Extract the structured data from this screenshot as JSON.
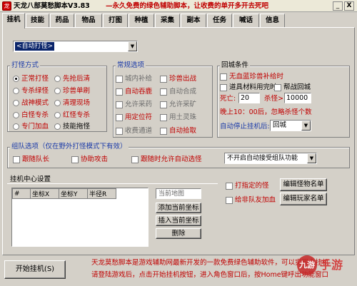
{
  "window": {
    "title": "天龙八部莫愁脚本V3.83",
    "slogan": "—永久免费的绿色辅助脚本，让收费的单开多开去死吧",
    "buttons": {
      "minimize": "_",
      "close": "X"
    }
  },
  "tabs": [
    "挂机",
    "技能",
    "药品",
    "物品",
    "打图",
    "种植",
    "采集",
    "副本",
    "任务",
    "喊话",
    "信息"
  ],
  "active_tab": "挂机",
  "route_select": {
    "value": "<自动打怪>"
  },
  "fight_mode": {
    "title": "打怪方式",
    "options": [
      {
        "label": "正常打怪",
        "checked": true
      },
      {
        "label": "先抢后清",
        "checked": false
      },
      {
        "label": "专杀绿怪",
        "checked": false
      },
      {
        "label": "珍兽单刷",
        "checked": false
      },
      {
        "label": "战神模式",
        "checked": false
      },
      {
        "label": "清理现场",
        "checked": false
      },
      {
        "label": "白怪专杀",
        "checked": false
      },
      {
        "label": "红怪专杀",
        "checked": false
      },
      {
        "label": "专门加血",
        "checked": false
      },
      {
        "label": "技能拖怪",
        "checked": false
      }
    ]
  },
  "common": {
    "title": "常规选项",
    "options": [
      {
        "label": "城内补给",
        "checked": false,
        "style": "gray"
      },
      {
        "label": "珍兽出战",
        "checked": false,
        "style": "red"
      },
      {
        "label": "自动吞鹿",
        "checked": false,
        "style": "red"
      },
      {
        "label": "自动合成",
        "checked": false,
        "style": "gray"
      },
      {
        "label": "允许采药",
        "checked": false,
        "style": "gray"
      },
      {
        "label": "允许采矿",
        "checked": false,
        "style": "gray"
      },
      {
        "label": "用定位符",
        "checked": false,
        "style": "red"
      },
      {
        "label": "用土灵珠",
        "checked": false,
        "style": "gray"
      },
      {
        "label": "收费通道",
        "checked": false,
        "style": "gray"
      },
      {
        "label": "自动拾取",
        "checked": false,
        "style": "red"
      }
    ]
  },
  "return_city": {
    "title": "回城条件",
    "no_pet_supply": "无血蓝珍兽补给时",
    "out_of_items": "道具材料用完时",
    "gang_return": "帮战回城",
    "death_label": "死亡:",
    "death_value": "20",
    "kill_label": "杀怪>",
    "kill_value": "10000",
    "note": "晚上10：00后，忽略杀怪个数",
    "auto_stop_label": "自动停止挂机后:",
    "auto_stop_value": "回城"
  },
  "team": {
    "title": "组队选项（仅在野外打怪模式下有效）",
    "follow_captain": "跟随队长",
    "assist_attack": "协助攻击",
    "follow_allow_auto": "跟随时允许自动选怪",
    "invite_select": "不开启自动接受组队功能"
  },
  "center": {
    "title": "挂机中心设置",
    "columns": [
      "#",
      "坐标X",
      "坐标Y",
      "半径R"
    ],
    "map_placeholder": "当前地图",
    "add_button": "添加当前坐标",
    "insert_button": "插入当前坐标",
    "delete_button": "删除"
  },
  "target": {
    "hit_specific": "打指定的怪",
    "edit_monster": "编辑怪物名单",
    "heal_friends": "给非队友加血",
    "edit_player": "编辑玩家名单"
  },
  "footer": {
    "start_button": "开始挂机(S)",
    "notice_line1": "天龙莫愁脚本是游戏辅助网最新开发的一款免费绿色辅助软件，可以实现全挂机",
    "notice_line2": "请登陆游戏后，点击开始挂机按钮，进入角色窗口后，按Home键呼出功能窗口"
  },
  "watermark": {
    "brand": "九游",
    "text": "手游"
  },
  "colors": {
    "accent_red": "#c00000",
    "group_title_blue": "#1a3aa8",
    "background": "#d4d0c8"
  }
}
